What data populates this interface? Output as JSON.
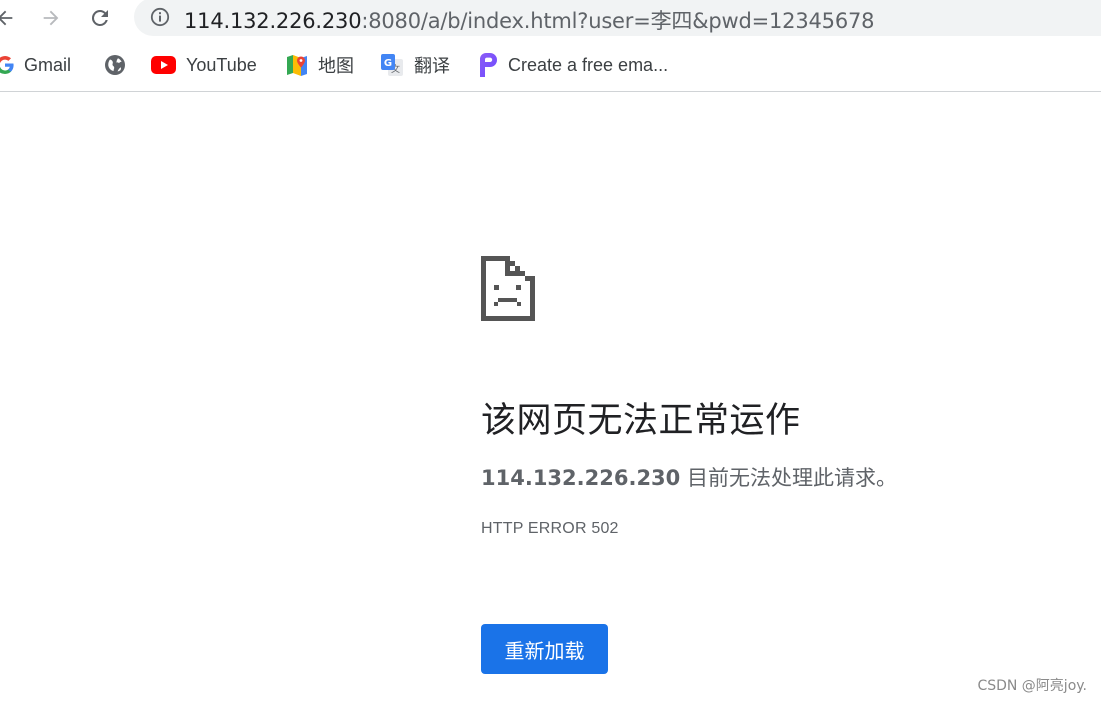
{
  "toolbar": {
    "url_host": "114.132.226.230",
    "url_rest": ":8080/a/b/index.html?user=李四&pwd=12345678"
  },
  "bookmarks": [
    {
      "label": "Gmail",
      "icon": "google-g-icon"
    },
    {
      "label": "",
      "icon": "globe-icon"
    },
    {
      "label": "YouTube",
      "icon": "youtube-icon"
    },
    {
      "label": "地图",
      "icon": "maps-icon"
    },
    {
      "label": "翻译",
      "icon": "translate-icon"
    },
    {
      "label": "Create a free ema...",
      "icon": "proton-p-icon"
    }
  ],
  "error": {
    "title": "该网页无法正常运作",
    "host_bold": "114.132.226.230",
    "description_rest": " 目前无法处理此请求。",
    "code": "HTTP ERROR 502",
    "reload_label": "重新加载"
  },
  "watermark": "CSDN @阿亮joy.",
  "colors": {
    "accent": "#1a73e8",
    "omnibox_bg": "#f1f3f4",
    "youtube_red": "#ff0000",
    "icon_gray": "#5f6368"
  }
}
